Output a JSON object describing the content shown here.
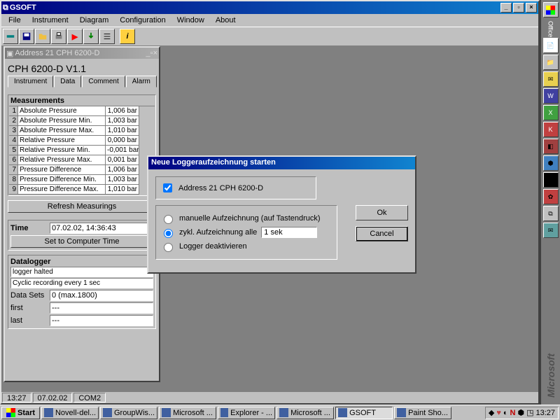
{
  "app": {
    "title": "GSOFT"
  },
  "menubar": [
    "File",
    "Instrument",
    "Diagram",
    "Configuration",
    "Window",
    "About"
  ],
  "status": {
    "time": "13:27",
    "date": "07.02.02",
    "port": "COM2"
  },
  "child": {
    "title": "Address 21 CPH 6200-D",
    "heading": "CPH 6200-D V1.1",
    "tabs": [
      "Instrument",
      "Data",
      "Comment",
      "Alarm"
    ],
    "measurements_title": "Measurements",
    "measurements": [
      {
        "idx": "1",
        "name": "Absolute Pressure",
        "val": "1,006 bar"
      },
      {
        "idx": "2",
        "name": "Absolute Pressure Min.",
        "val": "1,003 bar"
      },
      {
        "idx": "3",
        "name": "Absolute Pressure Max.",
        "val": "1,010 bar"
      },
      {
        "idx": "4",
        "name": "Relative Pressure",
        "val": "0,000 bar"
      },
      {
        "idx": "5",
        "name": "Relative Pressure Min.",
        "val": "-0,001 bar"
      },
      {
        "idx": "6",
        "name": "Relative Pressure Max.",
        "val": "0,001 bar"
      },
      {
        "idx": "7",
        "name": "Pressure Difference",
        "val": "1,006 bar"
      },
      {
        "idx": "8",
        "name": "Pressure Difference Min.",
        "val": "1,003 bar"
      },
      {
        "idx": "9",
        "name": "Pressure Difference Max.",
        "val": "1,010 bar"
      }
    ],
    "refresh_btn": "Refresh Measurings",
    "time_label": "Time",
    "time_value": "07.02.02, 14:36:43",
    "set_time_btn": "Set to Computer Time",
    "datalogger_title": "Datalogger",
    "dl_status1": "logger halted",
    "dl_status2": "Cyclic recording every 1 sec",
    "dl_sets_label": "Data Sets",
    "dl_sets_value": "0 (max.1800)",
    "dl_first_label": "first",
    "dl_first_value": "---",
    "dl_last_label": "last",
    "dl_last_value": "---"
  },
  "dialog": {
    "title": "Neue Loggeraufzeichnung starten",
    "device": "Address 21 CPH 6200-D",
    "opt_manual": "manuelle Aufzeichnung (auf Tastendruck)",
    "opt_cyclic": "zykl. Aufzeichnung alle",
    "opt_cyclic_value": "1 sek",
    "opt_deactivate": "Logger deaktivieren",
    "ok": "Ok",
    "cancel": "Cancel"
  },
  "office": {
    "label": "Office",
    "microsoft": "Microsoft"
  },
  "taskbar": {
    "start": "Start",
    "buttons": [
      "Novell-del...",
      "GroupWis...",
      "Microsoft ...",
      "Explorer - ...",
      "Microsoft ...",
      "GSOFT",
      "Paint Sho..."
    ],
    "active_index": 5,
    "clock": "13:27"
  }
}
